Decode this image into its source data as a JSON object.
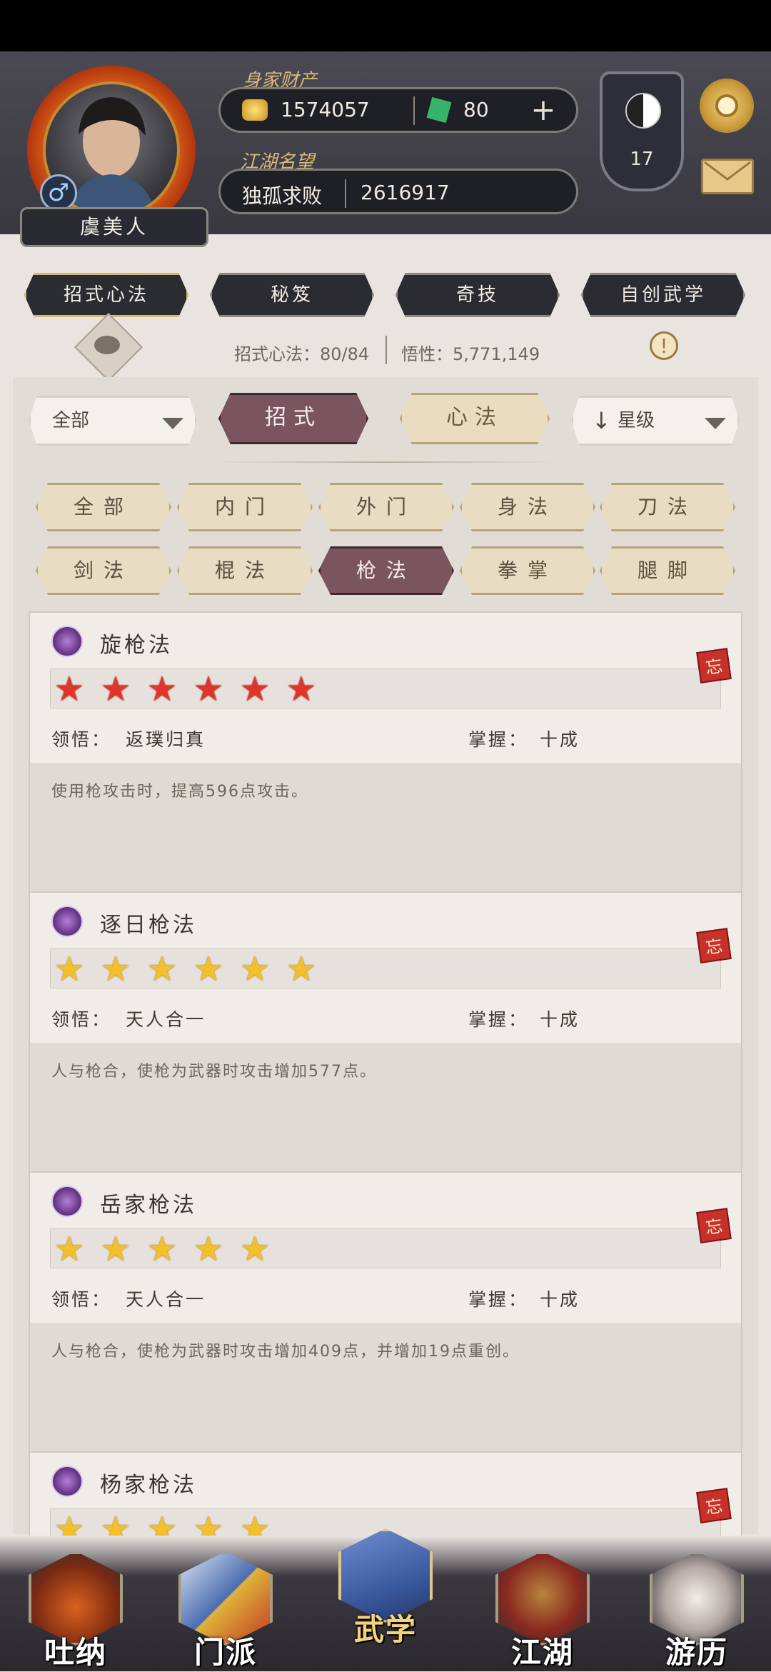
{
  "header": {
    "player_name": "虞美人",
    "gender_symbol": "♂",
    "wealth_label": "身家财产",
    "gold_amount": "1574057",
    "jade_amount": "80",
    "plus_symbol": "+",
    "reputation_label": "江湖名望",
    "reputation_title": "独孤求败",
    "reputation_value": "2616917",
    "rank_level": "17"
  },
  "top_tabs": [
    "招式心法",
    "秘笈",
    "奇技",
    "自创武学"
  ],
  "info_row": {
    "moves_text": "招式心法：80/84",
    "aptitude_text": "悟性：5,771,149",
    "alert_symbol": "!"
  },
  "filters": {
    "dropdown_left": "全部",
    "seg_moves": "招式",
    "seg_heart": "心法",
    "sort_label": "星级",
    "sort_arrow": "↓",
    "chips_row1": [
      "全部",
      "内门",
      "外门",
      "身法",
      "刀法"
    ],
    "chips_row2": [
      "剑法",
      "棍法",
      "枪法",
      "拳掌",
      "腿脚"
    ],
    "active_chip": "枪法"
  },
  "skills": [
    {
      "name": "旋枪法",
      "stars": 6,
      "star_color": "red",
      "insight_label": "领悟：",
      "insight": "返璞归真",
      "mastery_label": "掌握：",
      "mastery": "十成",
      "description": "使用枪攻击时，提高596点攻击。",
      "forget": "忘"
    },
    {
      "name": "逐日枪法",
      "stars": 6,
      "star_color": "gold",
      "insight_label": "领悟：",
      "insight": "天人合一",
      "mastery_label": "掌握：",
      "mastery": "十成",
      "description": "人与枪合，使枪为武器时攻击增加577点。",
      "forget": "忘"
    },
    {
      "name": "岳家枪法",
      "stars": 5,
      "star_color": "gold",
      "insight_label": "领悟：",
      "insight": "天人合一",
      "mastery_label": "掌握：",
      "mastery": "十成",
      "description": "人与枪合，使枪为武器时攻击增加409点，并增加19点重创。",
      "forget": "忘"
    },
    {
      "name": "杨家枪法",
      "stars": 5,
      "star_color": "gold",
      "forget": "忘"
    }
  ],
  "bottom_nav": [
    "吐纳",
    "门派",
    "武学",
    "江湖",
    "游历"
  ],
  "colors": {
    "active_tab": "#7a5560",
    "inactive_chip": "#e8dcc2",
    "header_bg": "#3f3e46"
  }
}
